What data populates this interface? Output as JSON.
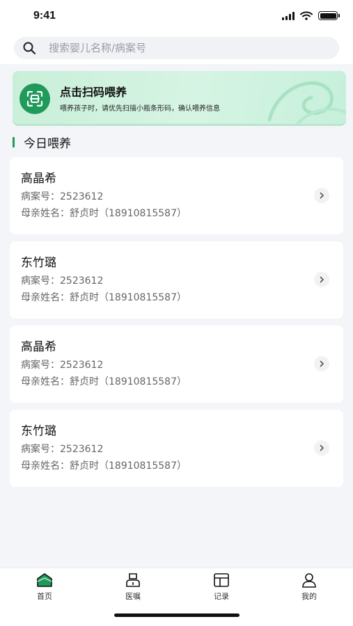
{
  "status_bar": {
    "time": "9:41"
  },
  "search": {
    "placeholder": "搜索婴儿名称/病案号"
  },
  "banner": {
    "title": "点击扫码喂养",
    "subtitle": "喂养孩子时，请优先扫描小瓶条形码，确认喂养信息"
  },
  "section": {
    "title": "今日喂养"
  },
  "records": [
    {
      "name": "高晶希",
      "case_label": "病案号：",
      "case_no": "2523612",
      "mother_label": "母亲姓名：",
      "mother": "舒贞时（18910815587）"
    },
    {
      "name": "东竹璐",
      "case_label": "病案号：",
      "case_no": "2523612",
      "mother_label": "母亲姓名：",
      "mother": "舒贞时（18910815587）"
    },
    {
      "name": "高晶希",
      "case_label": "病案号：",
      "case_no": "2523612",
      "mother_label": "母亲姓名：",
      "mother": "舒贞时（18910815587）"
    },
    {
      "name": "东竹璐",
      "case_label": "病案号：",
      "case_no": "2523612",
      "mother_label": "母亲姓名：",
      "mother": "舒贞时（18910815587）"
    }
  ],
  "tabs": [
    {
      "label": "首页",
      "icon": "home-icon",
      "active": true
    },
    {
      "label": "医嘱",
      "icon": "doctor-order-icon",
      "active": false
    },
    {
      "label": "记录",
      "icon": "record-icon",
      "active": false
    },
    {
      "label": "我的",
      "icon": "profile-icon",
      "active": false
    }
  ],
  "colors": {
    "accent": "#1f9a5a",
    "background": "#f3f5f8"
  }
}
